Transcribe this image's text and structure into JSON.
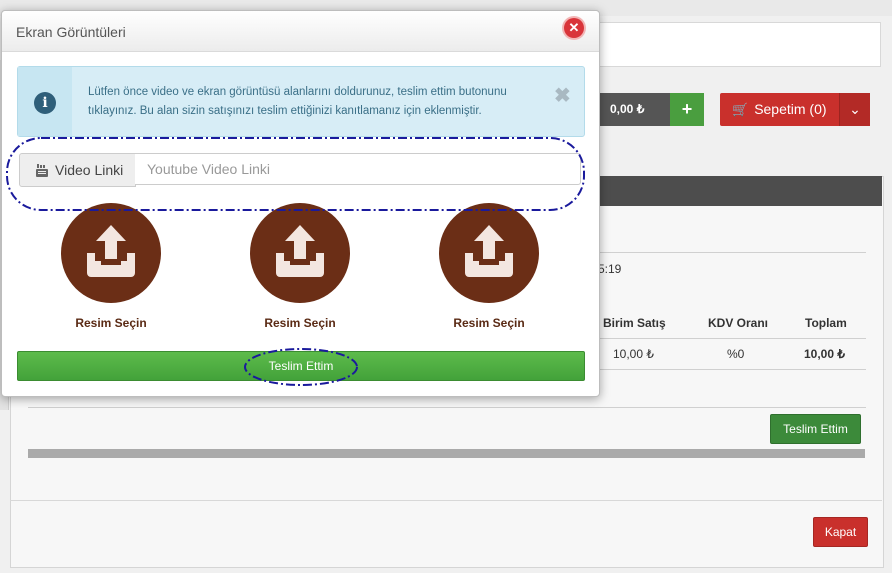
{
  "background": {
    "cart_price": "0,00 ₺",
    "cart_plus": "+",
    "cart_label": "Sepetim (0)",
    "time_fragment": "5:19",
    "table_headers": [
      "Birim Satış",
      "KDV Oranı",
      "Toplam"
    ],
    "table_row": [
      "10,00 ₺",
      "%0",
      "10,00 ₺"
    ],
    "submit_label": "Teslim Ettim",
    "close_label": "Kapat"
  },
  "modal": {
    "title": "Ekran Görüntüleri",
    "close_icon": "close-icon",
    "alert": {
      "icon": "info-icon",
      "line1": "Lütfen önce video ve ekran görüntüsü alanlarını doldurunuz, teslim ettim butonunu",
      "line2": "tıklayınız. Bu alan sizin satışınızı teslim ettiğinizi kanıtlamanız için eklenmiştir.",
      "close_glyph": "✖"
    },
    "video": {
      "icon": "youtube-icon",
      "label": "Video Linki",
      "value": "",
      "placeholder": "Youtube Video Linki"
    },
    "uploads": [
      {
        "label": "Resim Seçin",
        "icon": "upload-icon"
      },
      {
        "label": "Resim Seçin",
        "icon": "upload-icon"
      },
      {
        "label": "Resim Seçin",
        "icon": "upload-icon"
      }
    ],
    "submit_label": "Teslim Ettim"
  },
  "colors": {
    "upload_circle": "#6b2e16",
    "submit_green": "#4caf3f",
    "close_red": "#d9343a",
    "annotation_blue": "#1a1a9c"
  }
}
